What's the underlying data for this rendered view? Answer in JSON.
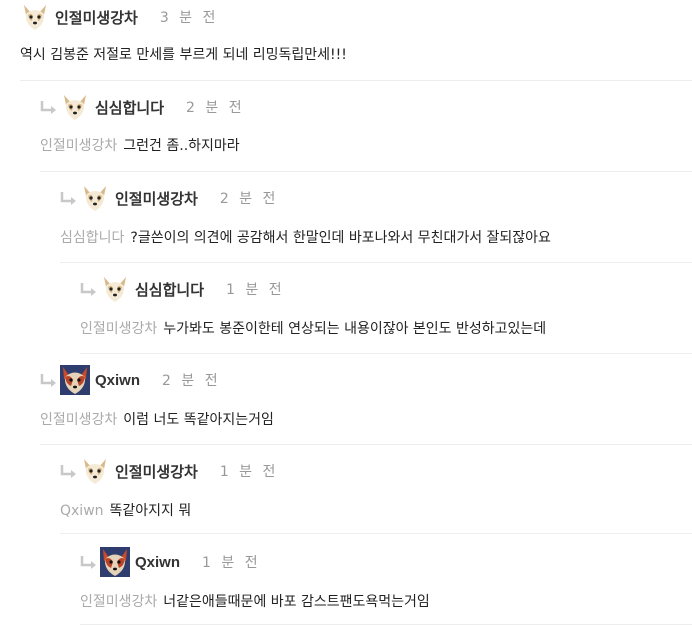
{
  "colors": {
    "text": "#222222",
    "mention": "#aaaaaa",
    "time": "#999999",
    "divider": "#eeeeee",
    "arrow": "#c8c8c8"
  },
  "comments": [
    {
      "nick": "인절미생강차",
      "time": "3 분 전",
      "mention": "",
      "text": "역시 김봉준 저절로 만세를 부르게 되네 리밍독립만세!!!",
      "avatar": "dog-avatar-icon"
    },
    {
      "nick": "심심합니다",
      "time": "2 분 전",
      "mention": "인절미생강차",
      "text": "그런건 좀..하지마라",
      "avatar": "dog-avatar-icon"
    },
    {
      "nick": "인절미생강차",
      "time": "2 분 전",
      "mention": "심심합니다",
      "text": "?글쓴이의 의견에 공감해서 한말인데 바포나와서 무친대가서 잘되잖아요",
      "avatar": "dog-avatar-icon"
    },
    {
      "nick": "심심합니다",
      "time": "1 분 전",
      "mention": "인절미생강차",
      "text": "누가봐도 봉준이한테 연상되는 내용이잖아 본인도 반성하고있는데",
      "avatar": "dog-avatar-icon"
    },
    {
      "nick": "Qxiwn",
      "time": "2 분 전",
      "mention": "인절미생강차",
      "text": "이럼 너도 똑같아지는거임",
      "avatar": "fox-avatar-icon"
    },
    {
      "nick": "인절미생강차",
      "time": "1 분 전",
      "mention": "Qxiwn",
      "text": "똑같아지지 뭐",
      "avatar": "dog-avatar-icon"
    },
    {
      "nick": "Qxiwn",
      "time": "1 분 전",
      "mention": "인절미생강차",
      "text": "너같은애들때문에 바포 감스트팬도욕먹는거임",
      "avatar": "fox-avatar-icon"
    }
  ]
}
